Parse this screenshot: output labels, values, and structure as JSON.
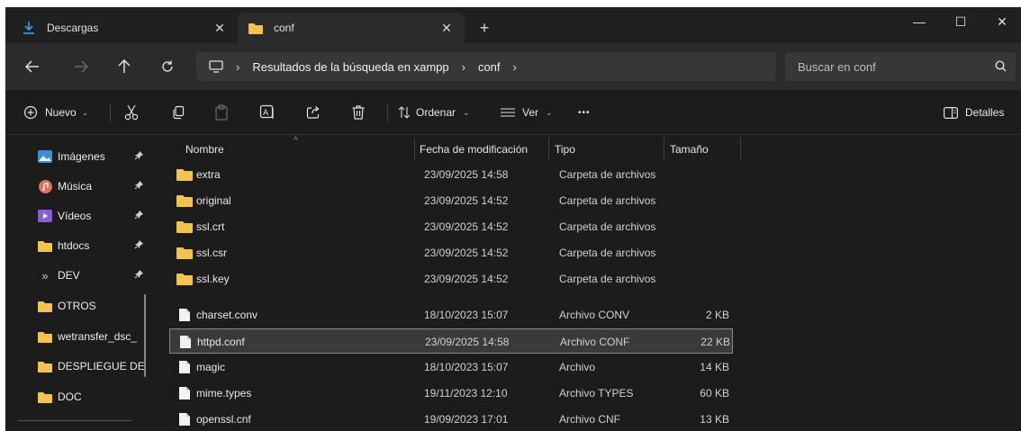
{
  "tabs": [
    {
      "label": "Descargas",
      "icon": "download-icon",
      "active": false
    },
    {
      "label": "conf",
      "icon": "folder-icon",
      "active": true
    }
  ],
  "window_controls": {
    "minimize": "—",
    "maximize": "☐",
    "close": "✕"
  },
  "address": {
    "crumbs": [
      "Resultados de la búsqueda en xampp",
      "conf"
    ]
  },
  "search": {
    "placeholder": "Buscar en conf"
  },
  "toolbar": {
    "new_label": "Nuevo",
    "sort_label": "Ordenar",
    "view_label": "Ver",
    "more_label": "•••",
    "details_label": "Detalles"
  },
  "sidebar": {
    "items": [
      {
        "label": "Imágenes",
        "icon": "pictures-icon",
        "pinned": true
      },
      {
        "label": "Música",
        "icon": "music-icon",
        "pinned": true
      },
      {
        "label": "Vídeos",
        "icon": "videos-icon",
        "pinned": true
      },
      {
        "label": "htdocs",
        "icon": "folder-icon",
        "pinned": true
      },
      {
        "label": "DEV",
        "icon": "double-chevron-icon",
        "pinned": true
      },
      {
        "label": "OTROS",
        "icon": "folder-icon",
        "pinned": false
      },
      {
        "label": "wetransfer_dsc_",
        "icon": "folder-icon",
        "pinned": false
      },
      {
        "label": "DESPLIEGUE DE",
        "icon": "folder-icon",
        "pinned": false
      },
      {
        "label": "DOC",
        "icon": "folder-icon",
        "pinned": false
      }
    ]
  },
  "columns": {
    "name": "Nombre",
    "date": "Fecha de modificación",
    "type": "Tipo",
    "size": "Tamaño"
  },
  "files": [
    {
      "name": "extra",
      "date": "23/09/2025 14:58",
      "type": "Carpeta de archivos",
      "size": "",
      "kind": "folder"
    },
    {
      "name": "original",
      "date": "23/09/2025 14:52",
      "type": "Carpeta de archivos",
      "size": "",
      "kind": "folder"
    },
    {
      "name": "ssl.crt",
      "date": "23/09/2025 14:52",
      "type": "Carpeta de archivos",
      "size": "",
      "kind": "folder"
    },
    {
      "name": "ssl.csr",
      "date": "23/09/2025 14:52",
      "type": "Carpeta de archivos",
      "size": "",
      "kind": "folder"
    },
    {
      "name": "ssl.key",
      "date": "23/09/2025 14:52",
      "type": "Carpeta de archivos",
      "size": "",
      "kind": "folder"
    },
    {
      "name": "charset.conv",
      "date": "18/10/2023 15:07",
      "type": "Archivo CONV",
      "size": "2 KB",
      "kind": "file"
    },
    {
      "name": "httpd.conf",
      "date": "23/09/2025 14:58",
      "type": "Archivo CONF",
      "size": "22 KB",
      "kind": "file",
      "selected": true
    },
    {
      "name": "magic",
      "date": "18/10/2023 15:07",
      "type": "Archivo",
      "size": "14 KB",
      "kind": "file"
    },
    {
      "name": "mime.types",
      "date": "19/11/2023 12:10",
      "type": "Archivo TYPES",
      "size": "60 KB",
      "kind": "file"
    },
    {
      "name": "openssl.cnf",
      "date": "19/09/2023 17:01",
      "type": "Archivo CNF",
      "size": "13 KB",
      "kind": "file"
    }
  ],
  "colors": {
    "folder": "#f2c44b",
    "accent": "#4cc2ff"
  }
}
